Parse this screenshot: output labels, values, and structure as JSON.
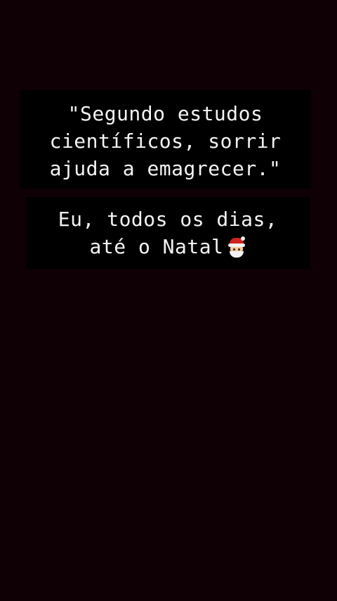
{
  "story": {
    "quote_lines": [
      "\"Segundo estudos",
      "científicos, sorrir",
      "ajuda a emagrecer.\""
    ],
    "reply_lines": [
      "Eu, todos os dias,",
      "até o Natal"
    ],
    "reply_emoji": "santa-face-icon",
    "colors": {
      "background": "#0f0006",
      "caption_background": "#000000",
      "text": "#f4f4f4"
    }
  }
}
